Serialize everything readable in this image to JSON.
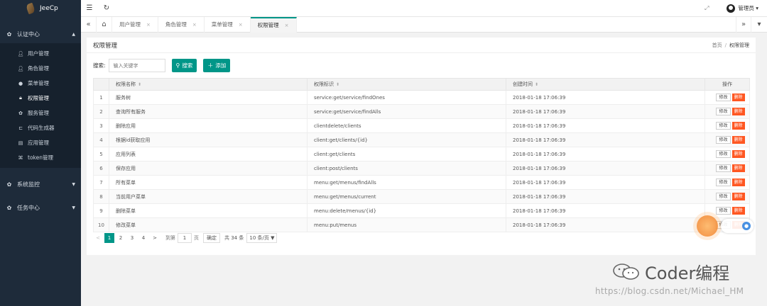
{
  "app": {
    "brand": "JeeCp"
  },
  "sidebar": {
    "groups": [
      {
        "label": "认证中心",
        "icon": "gear-icon",
        "expanded": true
      },
      {
        "label": "系统监控",
        "icon": "gear-icon"
      },
      {
        "label": "任务中心",
        "icon": "gear-icon"
      }
    ],
    "items": [
      {
        "label": "用户管理",
        "icon": "user-icon"
      },
      {
        "label": "角色管理",
        "icon": "user-icon"
      },
      {
        "label": "菜单管理",
        "icon": "circle-icon"
      },
      {
        "label": "权限管理",
        "icon": "lock-icon",
        "active": true
      },
      {
        "label": "服务管理",
        "icon": "gear-icon"
      },
      {
        "label": "代码生成器",
        "icon": "code-icon"
      },
      {
        "label": "应用管理",
        "icon": "doc-icon"
      },
      {
        "label": "token管理",
        "icon": "key-icon"
      }
    ]
  },
  "topbar": {
    "menu_icon": "☰",
    "refresh_icon": "↻",
    "fullscreen_icon": "⤢",
    "user": "管理员 ▾"
  },
  "tabs": [
    {
      "label": "用户管理",
      "close": "×"
    },
    {
      "label": "角色管理",
      "close": "×"
    },
    {
      "label": "菜单管理",
      "close": "×"
    },
    {
      "label": "权限管理",
      "close": "×",
      "active": true
    }
  ],
  "page": {
    "title": "权限管理",
    "breadcrumb": {
      "home": "首页",
      "sep": "/",
      "current": "权限管理"
    }
  },
  "search": {
    "label": "搜索:",
    "placeholder": "输入关键字",
    "search_button": "搜索",
    "add_button": "添加"
  },
  "table": {
    "headers": {
      "name": "权限名称",
      "perm": "权限标识",
      "created": "创建时间",
      "ops": "操作"
    },
    "edit_label": "修改",
    "delete_label": "删除",
    "rows": [
      {
        "no": "1",
        "name": "服务树",
        "perm": "service:get/service/findOnes",
        "created": "2018-01-18 17:06:39"
      },
      {
        "no": "2",
        "name": "查询所有服务",
        "perm": "service:get/service/findAlls",
        "created": "2018-01-18 17:06:39"
      },
      {
        "no": "3",
        "name": "删除应用",
        "perm": "clientdelete/clients",
        "created": "2018-01-18 17:06:39"
      },
      {
        "no": "4",
        "name": "根据id获取应用",
        "perm": "client:get/clients/{id}",
        "created": "2018-01-18 17:06:39"
      },
      {
        "no": "5",
        "name": "应用列表",
        "perm": "client:get/clients",
        "created": "2018-01-18 17:06:39"
      },
      {
        "no": "6",
        "name": "保存应用",
        "perm": "client:post/clients",
        "created": "2018-01-18 17:06:39"
      },
      {
        "no": "7",
        "name": "所有菜单",
        "perm": "menu:get/menus/findAlls",
        "created": "2018-01-18 17:06:39"
      },
      {
        "no": "8",
        "name": "当前用户菜单",
        "perm": "menu:get/menus/current",
        "created": "2018-01-18 17:06:39"
      },
      {
        "no": "9",
        "name": "删除菜单",
        "perm": "menu:delete/menus/{id}",
        "created": "2018-01-18 17:06:39"
      },
      {
        "no": "10",
        "name": "修改菜单",
        "perm": "menu:put/menus",
        "created": "2018-01-18 17:06:39"
      }
    ]
  },
  "pagination": {
    "prev": "<",
    "pages": [
      "1",
      "2",
      "3",
      "4"
    ],
    "current": "1",
    "next": ">",
    "goto_label": "到第",
    "goto_value": "1",
    "page_unit": "页",
    "confirm": "确定",
    "total": "共 34 条",
    "page_size": "10 条/页 ▼"
  },
  "watermark": {
    "brand": "Coder编程",
    "url": "https://blog.csdn.net/Michael_HM"
  }
}
